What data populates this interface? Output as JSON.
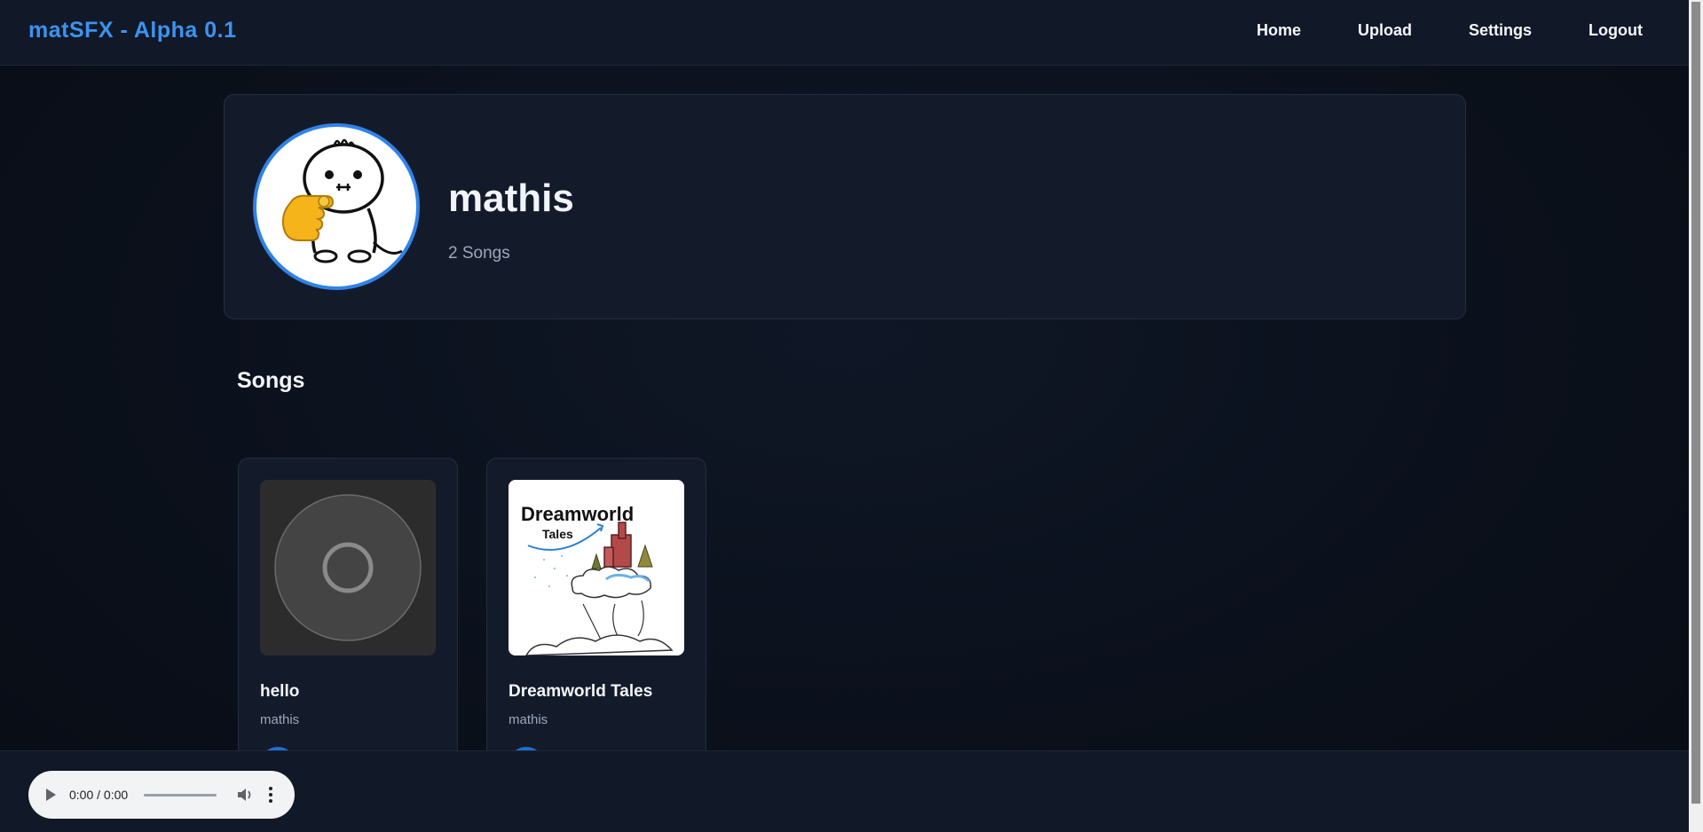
{
  "header": {
    "brand": "matSFX - Alpha 0.1",
    "nav": [
      "Home",
      "Upload",
      "Settings",
      "Logout"
    ]
  },
  "profile": {
    "username": "mathis",
    "song_count": "2 Songs"
  },
  "songs_section": {
    "title": "Songs",
    "items": [
      {
        "title": "hello",
        "artist": "mathis",
        "cover": "disc-placeholder-icon"
      },
      {
        "title": "Dreamworld Tales",
        "artist": "mathis",
        "cover": "album-art",
        "cover_text": [
          "Dreamworld",
          "Tales"
        ]
      }
    ]
  },
  "player": {
    "time": "0:00 / 0:00"
  },
  "colors": {
    "accent": "#3b93f0",
    "background": "#0b111c",
    "card": "#131b2b",
    "avatar_border": "#3182e8"
  }
}
